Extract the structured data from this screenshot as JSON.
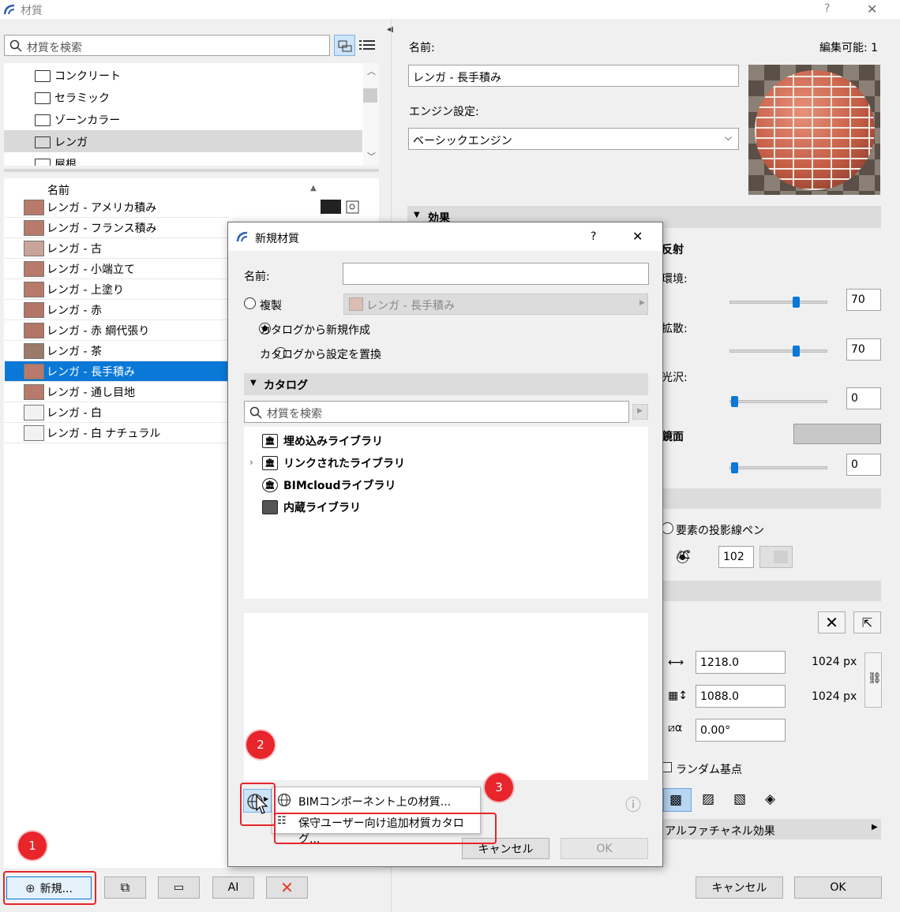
{
  "window": {
    "title": "材質",
    "help": "?",
    "close": "✕"
  },
  "left": {
    "search_placeholder": "材質を検索",
    "folders": [
      "コンクリート",
      "セラミック",
      "ゾーンカラー",
      "レンガ",
      "屋根"
    ],
    "list_header": "名前",
    "materials": [
      {
        "name": "レンガ - アメリカ積み",
        "color": "#b87a6a"
      },
      {
        "name": "レンガ - フランス積み",
        "color": "#b87a6a"
      },
      {
        "name": "レンガ - 古",
        "color": "#c9a49a"
      },
      {
        "name": "レンガ - 小端立て",
        "color": "#b87a6a"
      },
      {
        "name": "レンガ - 上塗り",
        "color": "#b87a6a"
      },
      {
        "name": "レンガ - 赤",
        "color": "#b37565"
      },
      {
        "name": "レンガ - 赤 綱代張り",
        "color": "#b37565"
      },
      {
        "name": "レンガ - 茶",
        "color": "#9a7a68"
      },
      {
        "name": "レンガ - 長手積み",
        "color": "#b87a6a"
      },
      {
        "name": "レンガ - 通し目地",
        "color": "#b87a6a"
      },
      {
        "name": "レンガ - 白",
        "color": "#f2f2f2"
      },
      {
        "name": "レンガ - 白 ナチュラル",
        "color": "#f2f2f2"
      }
    ],
    "selected_index": 8,
    "new_button": "新規...",
    "font_button": "AI"
  },
  "right": {
    "name_label": "名前:",
    "editable": "編集可能: 1",
    "name_value": "レンガ - 長手積み",
    "engine_label": "エンジン設定:",
    "engine_value": "ベーシックエンジン",
    "effects_header": "効果",
    "reflection": "反射",
    "ambient": "環境:",
    "ambient_value": "70",
    "diffuse": "拡散:",
    "diffuse_value": "70",
    "gloss": "光沢:",
    "gloss_value": "0",
    "mirror": "鏡面",
    "mirror_value": "0",
    "pen_option": "要素の投影線ペン",
    "pen_number": "102",
    "width_value": "1218.0",
    "width_px": "1024 px",
    "height_value": "1088.0",
    "height_px": "1024 px",
    "angle_value": "0.00°",
    "random_origin": "ランダム基点",
    "alpha_channel": "アルファチャネル効果",
    "cancel": "キャンセル",
    "ok": "OK"
  },
  "dialog": {
    "title": "新規材質",
    "help": "?",
    "close": "✕",
    "name_label": "名前:",
    "name_value": "",
    "opt_duplicate": "複製",
    "duplicate_source": "レンガ - 長手積み",
    "opt_catalog_new": "カタログから新規作成",
    "opt_catalog_replace": "カタログから設定を置換",
    "catalog_header": "カタログ",
    "catalog_search_placeholder": "材質を検索",
    "libraries": [
      "埋め込みライブラリ",
      "リンクされたライブラリ",
      "BIMcloudライブラリ",
      "内蔵ライブラリ"
    ],
    "menu_item_1": "BIMコンポーネント上の材質...",
    "menu_item_2": "保守ユーザー向け追加材質カタログ...",
    "cancel": "キャンセル",
    "ok": "OK"
  },
  "annotations": [
    "1",
    "2",
    "3"
  ]
}
